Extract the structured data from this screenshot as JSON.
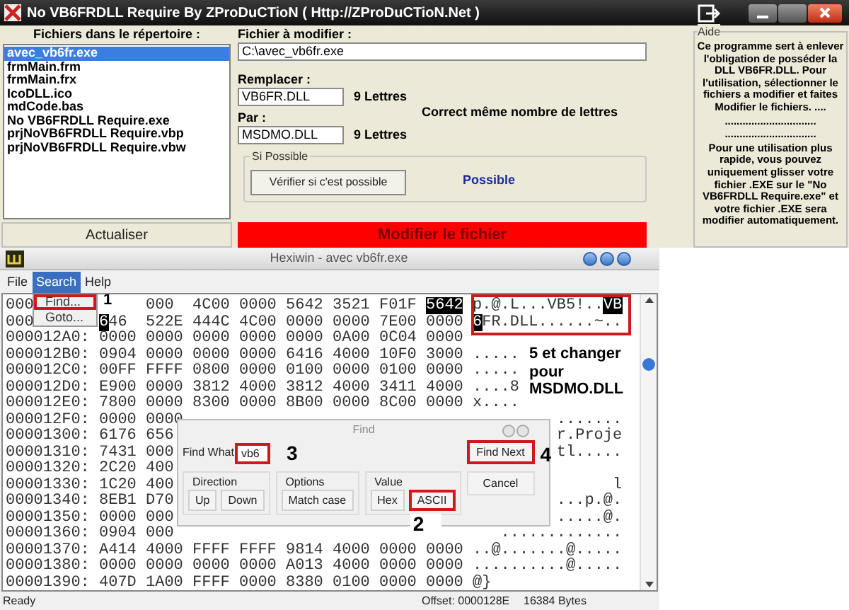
{
  "app": {
    "title": "No VB6FRDLL Require By ZProDuCTioN ( Http://ZProDuCTioN.Net )",
    "files_header": "Fichiers dans le répertoire :",
    "files": [
      {
        "name": "avec_vb6fr.exe",
        "selected": true
      },
      {
        "name": "frmMain.frm",
        "selected": false
      },
      {
        "name": "frmMain.frx",
        "selected": false
      },
      {
        "name": "IcoDLL.ico",
        "selected": false
      },
      {
        "name": "mdCode.bas",
        "selected": false
      },
      {
        "name": "No VB6FRDLL Require.exe",
        "selected": false
      },
      {
        "name": "prjNoVB6FRDLL Require.vbp",
        "selected": false
      },
      {
        "name": "prjNoVB6FRDLL Require.vbw",
        "selected": false
      }
    ],
    "refresh_button": "Actualiser",
    "target_label": "Fichier à modifier :",
    "target_value": "C:\\avec_vb6fr.exe",
    "replace_label": "Remplacer :",
    "replace_value": "VB6FR.DLL",
    "replace_count": "9 Lettres",
    "match_note": "Correct même nombre de lettres",
    "by_label": "Par :",
    "by_value": "MSDMO.DLL",
    "by_count": "9 Lettres",
    "check_group": "Si Possible",
    "check_button": "Vérifier si c'est possible",
    "check_result": "Possible",
    "modify_button": "Modifier le fichier",
    "help_title": "Aide",
    "help_paragraphs": [
      "Ce programme sert à enlever l'obligation de posséder la DLL VB6FR.DLL. Pour l'utilisation, sélectionner le fichiers a modifier et faites Modifier le fichiers.  ....",
      "...............................",
      "...............................",
      "Pour une utilisation plus rapide, vous pouvez uniquement glisser votre fichier .EXE sur le \"No VB6FRDLL Require.exe\" et votre fichier .EXE sera modifier automatiquement."
    ]
  },
  "hexwin": {
    "title": "Hexiwin - avec vb6fr.exe",
    "menu": [
      {
        "label": "File",
        "selected": false
      },
      {
        "label": "Search",
        "selected": true
      },
      {
        "label": "Help",
        "selected": false
      }
    ],
    "dropdown": [
      {
        "label": "Find...",
        "outlined": true,
        "step": "1"
      },
      {
        "label": "Goto...",
        "outlined": false
      }
    ],
    "ascii_outlined": true,
    "note": "5 et changer pour MSDMO.DLL",
    "rows": [
      {
        "address": "000",
        "cells": [
          null,
          "000",
          "4C00",
          "0000",
          "5642",
          "3521",
          "F01F",
          [
            {
              "text": "5642",
              "selected": true
            }
          ]
        ],
        "ascii": [
          {
            "text": "p.@.L...VB5!..",
            "selected": false
          },
          {
            "text": "VB",
            "selected": true
          }
        ]
      },
      {
        "address": "000",
        "cells": [
          [
            {
              "text": "6",
              "selected": true
            },
            {
              "text": "46",
              "selected": false
            }
          ],
          "522E",
          "444C",
          "4C00",
          "0000",
          "0000",
          "7E00",
          "0000"
        ],
        "ascii": [
          {
            "text": "6",
            "selected": true
          },
          {
            "text": "FR.DLL......~..",
            "selected": false
          }
        ]
      },
      {
        "address": "000012A0:",
        "cells": [
          "0000",
          "0000",
          "0000",
          "0000",
          "0000",
          "0A00",
          "0C04",
          "0000"
        ]
      },
      {
        "address": "000012B0:",
        "cells": [
          "0904",
          "0000",
          "0000",
          "0000",
          "6416",
          "4000",
          "10F0",
          "3000"
        ],
        "ascii": "....."
      },
      {
        "address": "000012C0:",
        "cells": [
          "00FF",
          "FFFF",
          "0800",
          "0000",
          "0100",
          "0000",
          "0100",
          "0000"
        ],
        "ascii": "....."
      },
      {
        "address": "000012D0:",
        "cells": [
          "E900",
          "0000",
          "3812",
          "4000",
          "3812",
          "4000",
          "3411",
          "4000"
        ],
        "ascii": "....8"
      },
      {
        "address": "000012E0:",
        "cells": [
          "7800",
          "0000",
          "8300",
          "0000",
          "8B00",
          "0000",
          "8C00",
          "0000"
        ],
        "ascii": "x...."
      },
      {
        "address": "000012F0:",
        "cells": [
          "0000",
          "0000",
          null,
          null,
          null,
          null,
          null,
          null
        ],
        "ascii": "......."
      },
      {
        "address": "00001300:",
        "cells": [
          "6176",
          "656",
          null,
          null,
          null,
          null,
          null,
          null
        ],
        "ascii": "r.Proje"
      },
      {
        "address": "00001310:",
        "cells": [
          "7431",
          "000",
          null,
          null,
          null,
          null,
          null,
          null
        ],
        "ascii": "tl....."
      },
      {
        "address": "00001320:",
        "cells": [
          "2C20",
          "400",
          null,
          null,
          null,
          null,
          null,
          null
        ]
      },
      {
        "address": "00001330:",
        "cells": [
          "1C20",
          "400",
          null,
          null,
          null,
          null,
          null,
          null
        ],
        "ascii": "l"
      },
      {
        "address": "00001340:",
        "cells": [
          "8EB1",
          "D70",
          null,
          null,
          null,
          null,
          null,
          null
        ],
        "ascii": "...p.@."
      },
      {
        "address": "00001350:",
        "cells": [
          "0000",
          "000",
          null,
          null,
          null,
          null,
          null,
          null
        ],
        "ascii": ".....@."
      },
      {
        "address": "00001360:",
        "cells": [
          "0904",
          "000",
          null,
          null,
          null,
          null,
          null,
          null
        ],
        "ascii": "............."
      },
      {
        "address": "00001370:",
        "cells": [
          "A414",
          "4000",
          "FFFF",
          "FFFF",
          "9814",
          "4000",
          "0000",
          "0000"
        ],
        "ascii": "..@.......@....."
      },
      {
        "address": "00001380:",
        "cells": [
          "0000",
          "0000",
          "0000",
          "0000",
          "A013",
          "4000",
          "0000",
          "0000"
        ],
        "ascii": "..........@....."
      },
      {
        "address": "00001390:",
        "cells": [
          "407D",
          "1A00",
          "FFFF",
          "0000",
          "8380",
          "0100",
          "0000",
          "0000"
        ],
        "ascii": "@}"
      }
    ],
    "find": {
      "title": "Find",
      "label": "Find What",
      "value": "vb6",
      "value_outlined": true,
      "value_step": "3",
      "next_button": {
        "label": "Find Next",
        "outlined": true,
        "step": "4"
      },
      "cancel_button": "Cancel",
      "groups": [
        {
          "title": "Direction",
          "buttons": [
            {
              "label": "Up",
              "outlined": false
            },
            {
              "label": "Down",
              "outlined": false
            }
          ]
        },
        {
          "title": "Options",
          "buttons": [
            {
              "label": "Match case",
              "outlined": false
            }
          ]
        },
        {
          "title": "Value",
          "buttons": [
            {
              "label": "Hex",
              "outlined": false
            },
            {
              "label": "ASCII",
              "outlined": true,
              "step": "2"
            }
          ]
        }
      ]
    },
    "status": {
      "ready": "Ready",
      "offset": "Offset: 0000128E",
      "size": "16384 Bytes"
    }
  }
}
